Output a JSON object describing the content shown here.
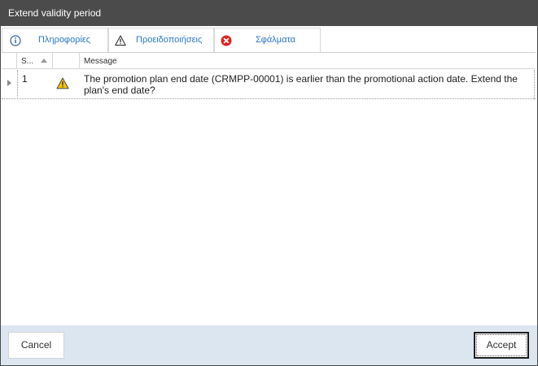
{
  "window": {
    "title": "Extend validity period"
  },
  "tabs": [
    {
      "label": "Πληροφορίες",
      "icon": "info-icon"
    },
    {
      "label": "Προειδοποιήσεις",
      "icon": "warning-icon"
    },
    {
      "label": "Σφάλματα",
      "icon": "error-icon"
    }
  ],
  "grid": {
    "columns": {
      "seq": "S...",
      "icon": "",
      "message": "Message"
    },
    "sort_column": "seq",
    "rows": [
      {
        "seq": "1",
        "icon": "warning-icon",
        "message": "The promotion plan end date (CRMPP-00001) is earlier than the promotional action date. Extend the plan's end date?"
      }
    ]
  },
  "footer": {
    "cancel_label": "Cancel",
    "accept_label": "Accept"
  },
  "colors": {
    "titlebar": "#4b4b4b",
    "tab_label": "#2a77c9",
    "footer_bg": "#dce6f1",
    "error_red": "#e02020",
    "warning_yellow": "#f5c400"
  }
}
